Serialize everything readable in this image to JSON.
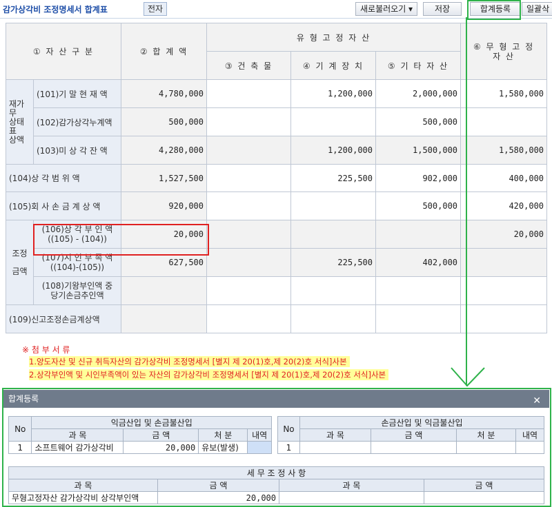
{
  "toolbar": {
    "title": "감가상각비 조정명세서 합계표",
    "tag": "전자",
    "buttons": [
      "새로불러오기 ▾",
      "저장",
      "합계등록",
      "일괄삭"
    ]
  },
  "main": {
    "col_category": "① 자 산 구 분",
    "col_total": "② 합  계  액",
    "col_tangible": "유   형   고   정   자   산",
    "col_building": "③ 건 축 물",
    "col_machine": "④ 기 계 장 치",
    "col_other": "⑤ 기 타 자 산",
    "col_intangible": "⑥ 무 형 고 정\n자          산",
    "group_fs": "재가\n무\n상태\n표\n상액",
    "group_adj": "조정\n\n금액",
    "rows": [
      {
        "label": "(101)기 말 현 재 액",
        "total": "4,780,000",
        "building": "",
        "machine": "1,200,000",
        "other": "2,000,000",
        "intangible": "1,580,000"
      },
      {
        "label": "(102)감가상각누계액",
        "total": "500,000",
        "building": "",
        "machine": "",
        "other": "500,000",
        "intangible": ""
      },
      {
        "label": "(103)미 상 각 잔 액",
        "total": "4,280,000",
        "building": "",
        "machine": "1,200,000",
        "other": "1,500,000",
        "intangible": "1,580,000"
      },
      {
        "label": "(104)상  각    범  위  액",
        "total": "1,527,500",
        "building": "",
        "machine": "225,500",
        "other": "902,000",
        "intangible": "400,000"
      },
      {
        "label": "(105)회 사 손 금 계 상 액",
        "total": "920,000",
        "building": "",
        "machine": "",
        "other": "500,000",
        "intangible": "420,000"
      },
      {
        "label": "(106)상 각 부 인 액\n((105) - (104))",
        "total": "20,000",
        "building": "",
        "machine": "",
        "other": "",
        "intangible": "20,000"
      },
      {
        "label": "(107)시 인 부 족 액\n((104)-(105))",
        "total": "627,500",
        "building": "",
        "machine": "225,500",
        "other": "402,000",
        "intangible": ""
      },
      {
        "label": "(108)기왕부인액 중\n당기손금추인액",
        "total": "",
        "building": "",
        "machine": "",
        "other": "",
        "intangible": ""
      },
      {
        "label": "(109)신고조정손금계상액",
        "total": "",
        "building": "",
        "machine": "",
        "other": "",
        "intangible": ""
      }
    ]
  },
  "notes": {
    "heading": "※ 첨 부 서 류",
    "line1": "1.양도자산 및 신규 취득자산의 감가상각비 조정명세서 [별지 제 20(1)호,제 20(2)호 서식]사본",
    "line2": "2.상각부인액 및 시인부족액이 있는 자산의 감가상각비 조정명세서 [별지 제 20(1)호,제 20(2)호 서식]사본"
  },
  "modal": {
    "title": "합계등록",
    "close": "✕",
    "left": {
      "header": "익금산입 및 손금불산입",
      "no": "No",
      "cols": [
        "과   목",
        "금   액",
        "처   분",
        "내역"
      ],
      "row": {
        "no": "1",
        "subject": "소프트웨어 감가상각비",
        "amount": "20,000",
        "disposal": "유보(발생)"
      }
    },
    "right": {
      "header": "손금산입 및 익금불산입",
      "no": "No",
      "cols": [
        "과   목",
        "금   액",
        "처   분",
        "내역"
      ],
      "row": {
        "no": "1"
      }
    },
    "tax": {
      "header": "세 무 조 정 사 항",
      "cols": [
        "과     목",
        "금     액",
        "과     목",
        "금     액"
      ],
      "row": {
        "subject": "무형고정자산 감가상각비 상각부인액",
        "amount": "20,000"
      }
    }
  }
}
